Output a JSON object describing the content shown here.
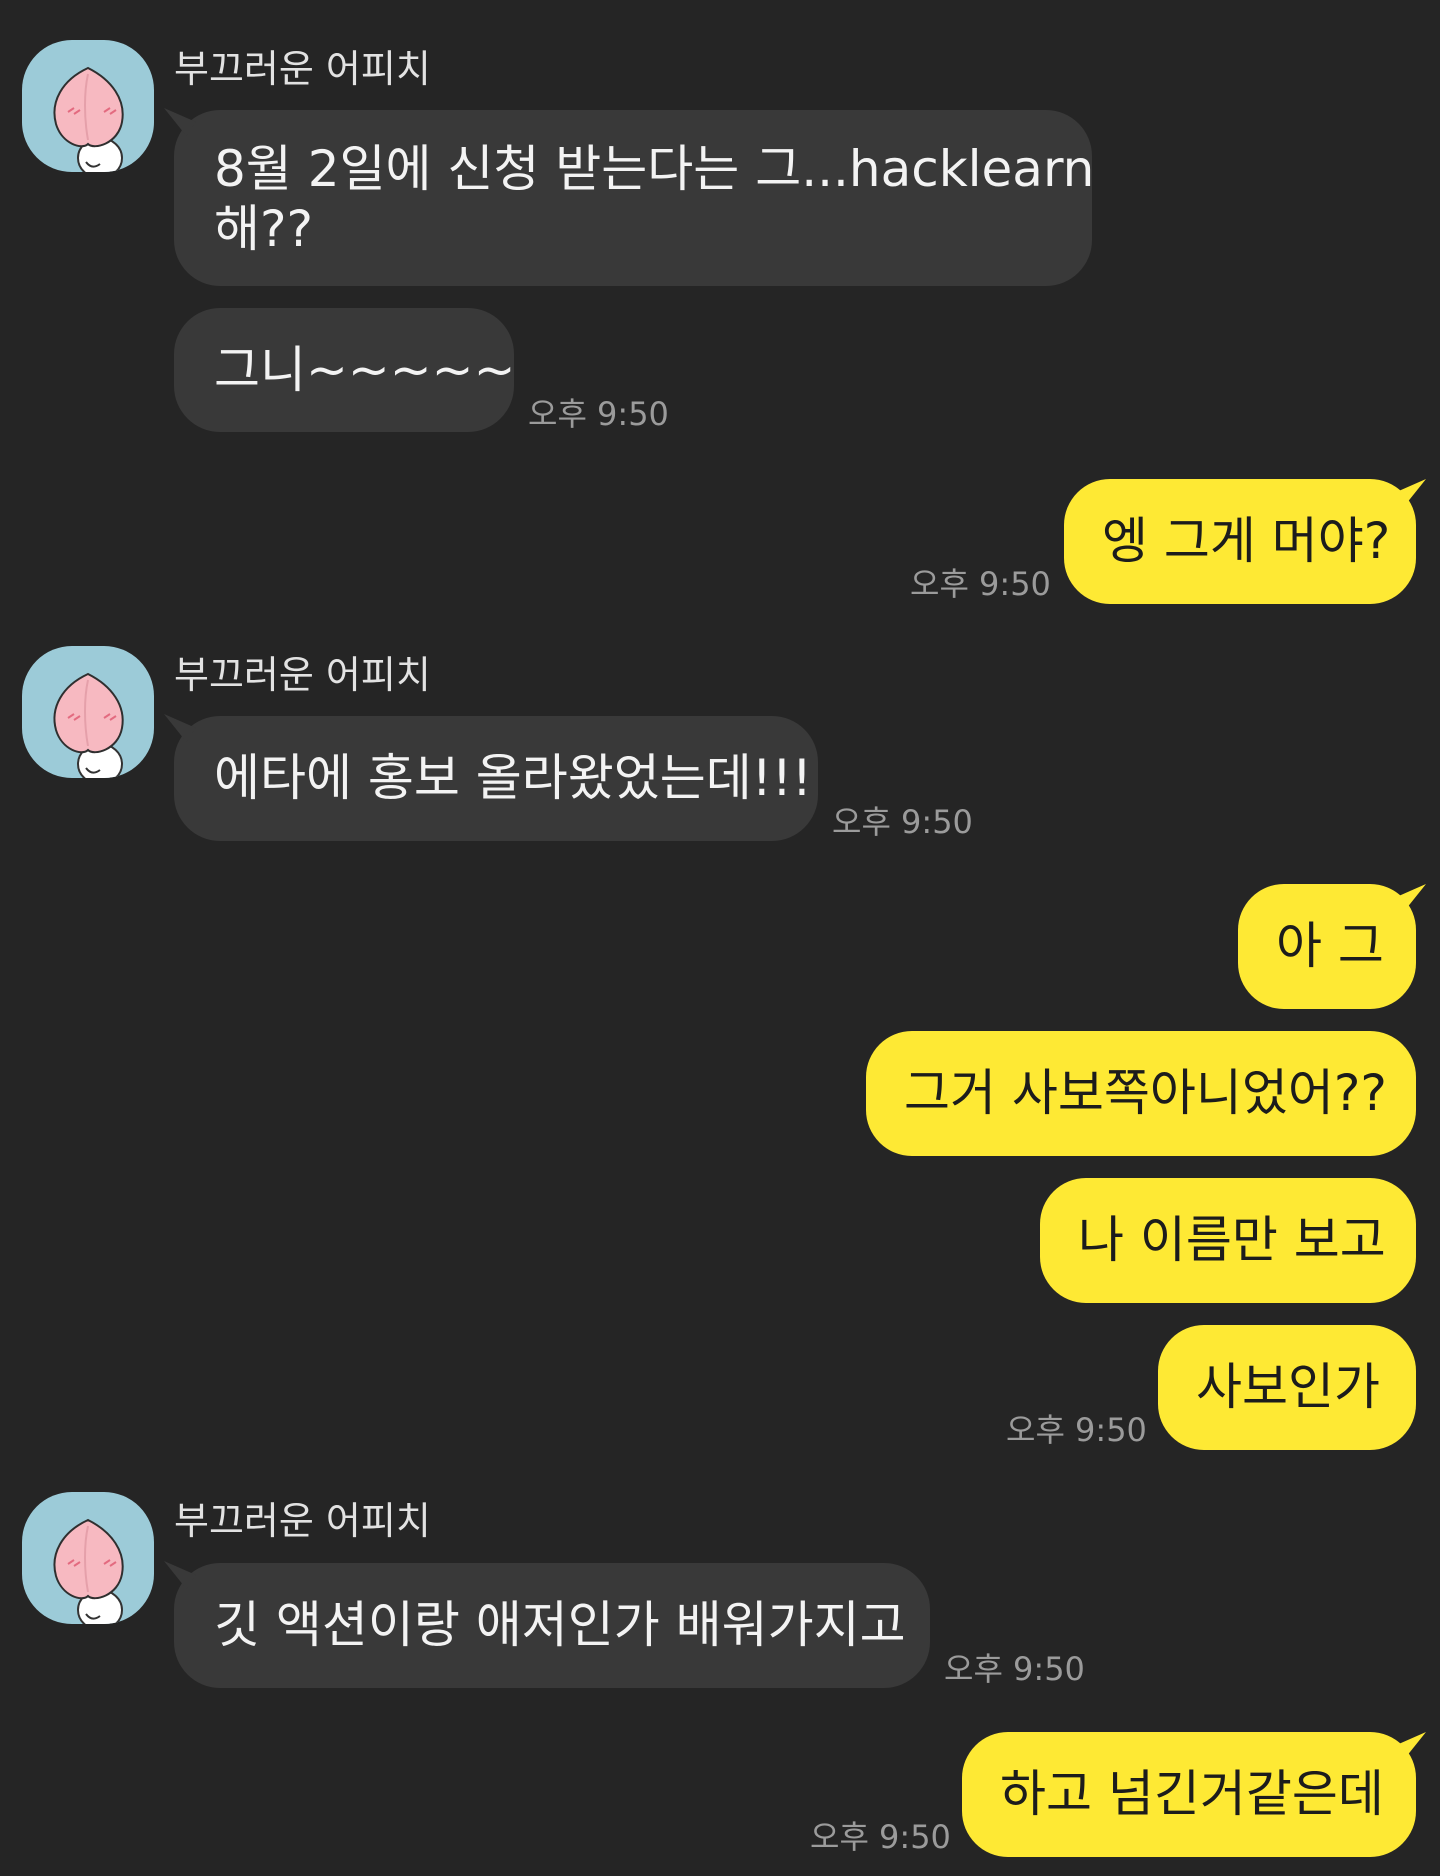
{
  "contact": {
    "name": "부끄러운 어피치",
    "avatar_icon": "apeach-avatar-icon"
  },
  "colors": {
    "background": "#252525",
    "incoming_bubble": "#393939",
    "outgoing_bubble": "#fee934",
    "avatar_background": "#9ccbd8",
    "timestamp": "#9b9b9b"
  },
  "messages": [
    {
      "direction": "in",
      "lines": [
        "8월 2일에 신청 받는다는 그...hacklearn",
        "해??"
      ]
    },
    {
      "direction": "in",
      "text": "그니~~~~~",
      "time": "오후 9:50"
    },
    {
      "direction": "out",
      "text": "엥 그게 머야?",
      "time": "오후 9:50"
    },
    {
      "direction": "in",
      "text": "에타에 홍보 올라왔었는데!!!",
      "time": "오후 9:50"
    },
    {
      "direction": "out",
      "text": "아 그"
    },
    {
      "direction": "out",
      "text": "그거 사보쪽아니었어??"
    },
    {
      "direction": "out",
      "text": "나 이름만 보고"
    },
    {
      "direction": "out",
      "text": "사보인가",
      "time": "오후 9:50"
    },
    {
      "direction": "in",
      "text": "깃 액션이랑 애저인가 배워가지고",
      "time": "오후 9:50"
    },
    {
      "direction": "out",
      "text": "하고 넘긴거같은데",
      "time": "오후 9:50"
    }
  ]
}
